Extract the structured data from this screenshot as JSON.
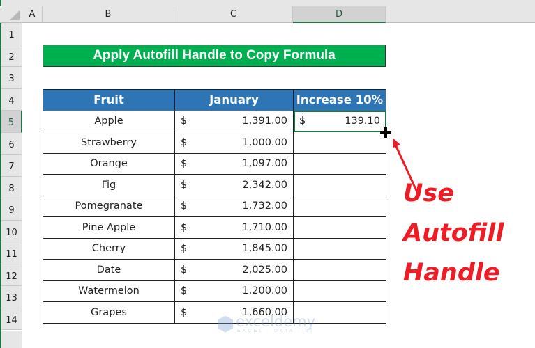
{
  "columns": [
    "A",
    "B",
    "C",
    "D"
  ],
  "selected_column": "D",
  "rows": [
    "1",
    "2",
    "3",
    "4",
    "5",
    "6",
    "7",
    "8",
    "9",
    "10",
    "11",
    "12",
    "13",
    "14"
  ],
  "selected_row": "5",
  "title": "Apply Autofill Handle to Copy Formula",
  "table": {
    "headers": [
      "Fruit",
      "January",
      "Increase 10%"
    ],
    "currency_symbol": "$",
    "rows": [
      {
        "fruit": "Apple",
        "january": "1,391.00",
        "increase": "139.10"
      },
      {
        "fruit": "Strawberry",
        "january": "1,000.00",
        "increase": ""
      },
      {
        "fruit": "Orange",
        "january": "1,097.00",
        "increase": ""
      },
      {
        "fruit": "Fig",
        "january": "2,342.00",
        "increase": ""
      },
      {
        "fruit": "Pomegranate",
        "january": "1,732.00",
        "increase": ""
      },
      {
        "fruit": "Pine Apple",
        "january": "1,710.00",
        "increase": ""
      },
      {
        "fruit": "Cherry",
        "january": "1,845.00",
        "increase": ""
      },
      {
        "fruit": "Date",
        "january": "2,025.00",
        "increase": ""
      },
      {
        "fruit": "Watermelon",
        "january": "1,200.00",
        "increase": ""
      },
      {
        "fruit": "Grapes",
        "january": "1,660.00",
        "increase": ""
      }
    ]
  },
  "annotation": {
    "lines": [
      "Use",
      "Autofill",
      "Handle"
    ],
    "color": "#ee1c25"
  },
  "watermark": {
    "name": "exceldemy",
    "tagline": "EXCEL · DATA · BI"
  },
  "colors": {
    "title_bg": "#00b050",
    "header_bg": "#2e75b6",
    "selection": "#217346"
  }
}
